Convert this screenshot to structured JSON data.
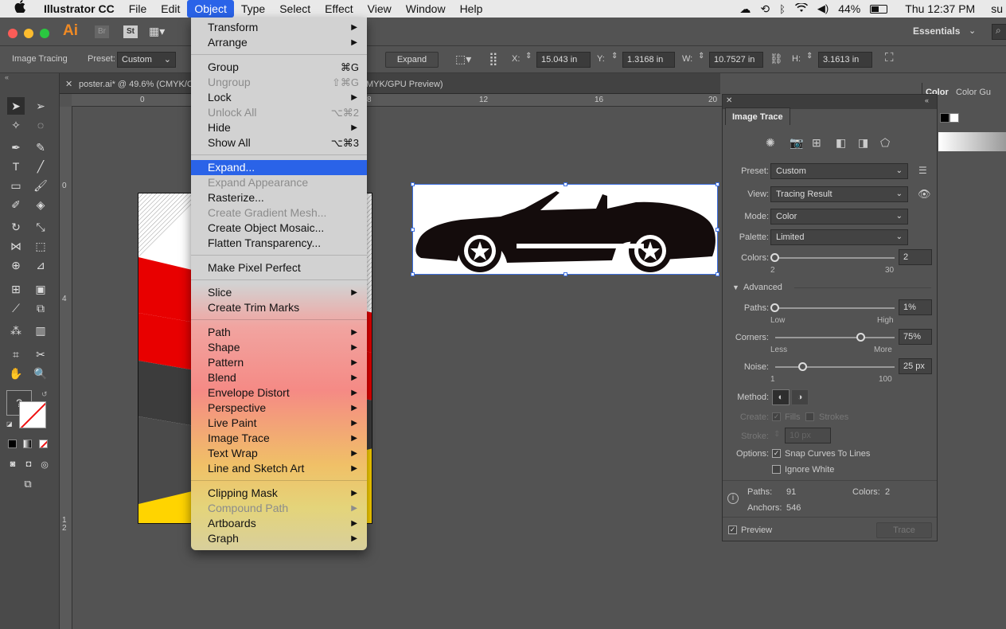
{
  "macbar": {
    "app": "Illustrator CC",
    "menus": [
      "File",
      "Edit",
      "Object",
      "Type",
      "Select",
      "Effect",
      "View",
      "Window",
      "Help"
    ],
    "active_menu": "Object",
    "battery": "44%",
    "clock": "Thu 12:37 PM",
    "user": "su"
  },
  "appbar": {
    "logo": "Ai",
    "br": "Br",
    "st": "St",
    "workspace": "Essentials"
  },
  "controlbar": {
    "mode_label": "Image Tracing",
    "preset_label": "Preset:",
    "preset_value": "Custom",
    "expand_btn": "Expand",
    "x_label": "X:",
    "x_value": "15.043 in",
    "y_label": "Y:",
    "y_value": "1.3168 in",
    "w_label": "W:",
    "w_value": "10.7527 in",
    "h_label": "H:",
    "h_value": "3.1613 in"
  },
  "doc_tab": {
    "title": "poster.ai* @ 49.6% (CMYK/C",
    "suffix": "MYK/GPU Preview)"
  },
  "ruler": {
    "h_marks": [
      "0",
      "12",
      "16",
      "20",
      "8"
    ],
    "v_marks": [
      "0",
      "4",
      "1",
      "2"
    ]
  },
  "object_menu": {
    "items": [
      {
        "label": "Transform",
        "submenu": true
      },
      {
        "label": "Arrange",
        "submenu": true
      },
      {
        "sep": true
      },
      {
        "label": "Group",
        "shortcut": "⌘G"
      },
      {
        "label": "Ungroup",
        "shortcut": "⇧⌘G",
        "disabled": true
      },
      {
        "label": "Lock",
        "submenu": true
      },
      {
        "label": "Unlock All",
        "shortcut": "⌥⌘2",
        "disabled": true
      },
      {
        "label": "Hide",
        "submenu": true
      },
      {
        "label": "Show All",
        "shortcut": "⌥⌘3"
      },
      {
        "sep": true
      },
      {
        "label": "Expand...",
        "highlighted": true
      },
      {
        "label": "Expand Appearance",
        "disabled": true
      },
      {
        "label": "Rasterize..."
      },
      {
        "label": "Create Gradient Mesh...",
        "disabled": true
      },
      {
        "label": "Create Object Mosaic..."
      },
      {
        "label": "Flatten Transparency..."
      },
      {
        "sep": true
      },
      {
        "label": "Make Pixel Perfect"
      },
      {
        "sep": true
      },
      {
        "label": "Slice",
        "submenu": true
      },
      {
        "label": "Create Trim Marks"
      },
      {
        "sep": true
      },
      {
        "label": "Path",
        "submenu": true
      },
      {
        "label": "Shape",
        "submenu": true
      },
      {
        "label": "Pattern",
        "submenu": true
      },
      {
        "label": "Blend",
        "submenu": true
      },
      {
        "label": "Envelope Distort",
        "submenu": true
      },
      {
        "label": "Perspective",
        "submenu": true
      },
      {
        "label": "Live Paint",
        "submenu": true
      },
      {
        "label": "Image Trace",
        "submenu": true
      },
      {
        "label": "Text Wrap",
        "submenu": true
      },
      {
        "label": "Line and Sketch Art",
        "submenu": true
      },
      {
        "sep": true
      },
      {
        "label": "Clipping Mask",
        "submenu": true
      },
      {
        "label": "Compound Path",
        "submenu": true,
        "disabled": true
      },
      {
        "label": "Artboards",
        "submenu": true
      },
      {
        "label": "Graph",
        "submenu": true
      }
    ]
  },
  "image_trace": {
    "title": "Image Trace",
    "preset_label": "Preset:",
    "preset": "Custom",
    "view_label": "View:",
    "view": "Tracing Result",
    "mode_label": "Mode:",
    "mode": "Color",
    "palette_label": "Palette:",
    "palette": "Limited",
    "colors_label": "Colors:",
    "colors_value": "2",
    "colors_min": "2",
    "colors_max": "30",
    "advanced": "Advanced",
    "paths_label": "Paths:",
    "paths_value": "1%",
    "paths_low": "Low",
    "paths_high": "High",
    "corners_label": "Corners:",
    "corners_value": "75%",
    "corners_less": "Less",
    "corners_more": "More",
    "noise_label": "Noise:",
    "noise_value": "25 px",
    "noise_min": "1",
    "noise_max": "100",
    "method_label": "Method:",
    "create_label": "Create:",
    "fills": "Fills",
    "strokes": "Strokes",
    "stroke_label": "Stroke:",
    "stroke_value": "10 px",
    "options_label": "Options:",
    "snap": "Snap Curves To Lines",
    "ignore_white": "Ignore White",
    "stat_paths_label": "Paths:",
    "stat_paths": "91",
    "stat_colors_label": "Colors:",
    "stat_colors": "2",
    "stat_anchors_label": "Anchors:",
    "stat_anchors": "546",
    "preview": "Preview",
    "trace_btn": "Trace"
  },
  "color_panel": {
    "tab1": "Color",
    "tab2": "Color Gu"
  },
  "tools": {
    "unknown": "?"
  }
}
